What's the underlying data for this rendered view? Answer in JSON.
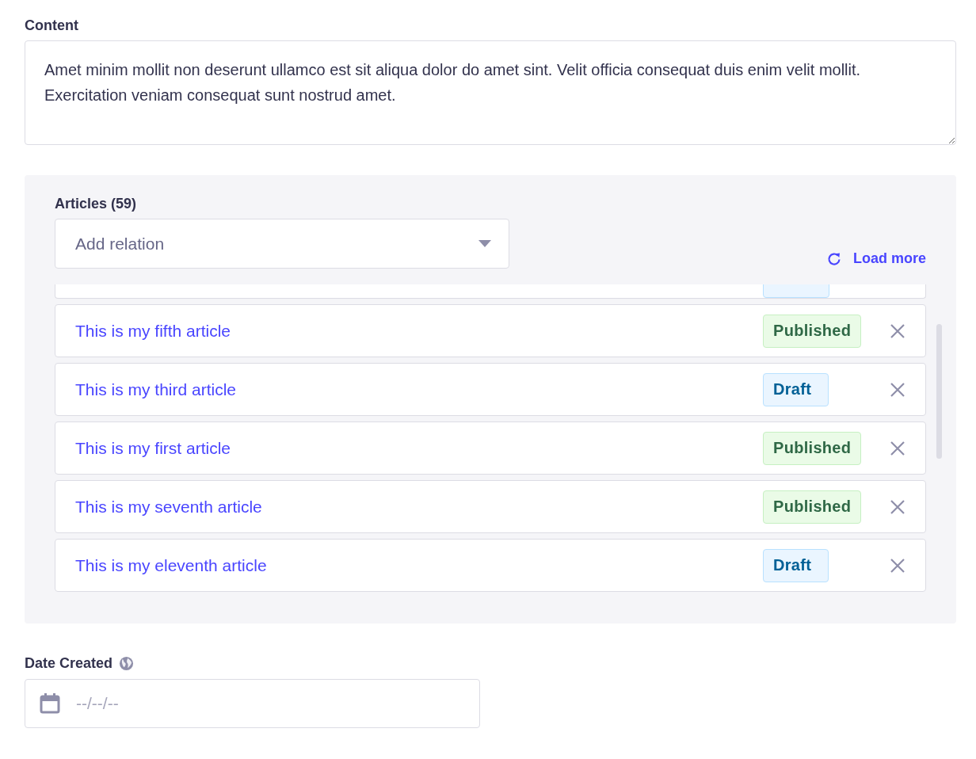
{
  "content": {
    "label": "Content",
    "value": "Amet minim mollit non deserunt ullamco est sit aliqua dolor do amet sint. Velit officia consequat duis enim velit mollit. Exercitation veniam consequat sunt nostrud amet."
  },
  "relation": {
    "label": "Articles (59)",
    "placeholder": "Add relation",
    "load_more": "Load more",
    "scrolled": true,
    "items": [
      {
        "title": "This is my fifth article",
        "status": "Published",
        "kind": "published"
      },
      {
        "title": "This is my third article",
        "status": "Draft",
        "kind": "draft"
      },
      {
        "title": "This is my first article",
        "status": "Published",
        "kind": "published"
      },
      {
        "title": "This is my seventh article",
        "status": "Published",
        "kind": "published"
      },
      {
        "title": "This is my eleventh article",
        "status": "Draft",
        "kind": "draft"
      }
    ]
  },
  "date": {
    "label": "Date Created",
    "placeholder": "--/--/--"
  }
}
